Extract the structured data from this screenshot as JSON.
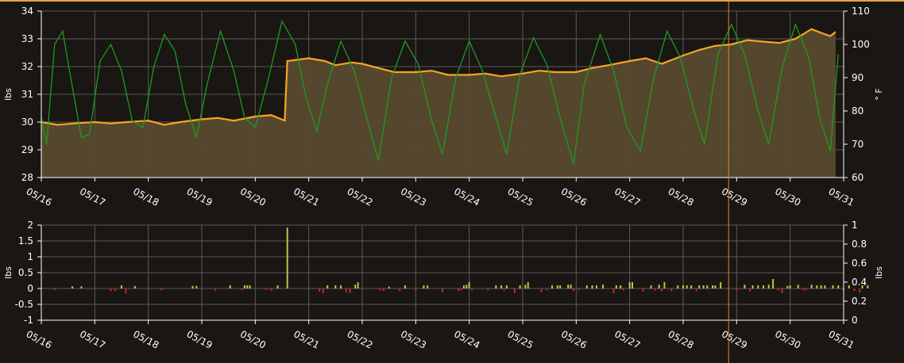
{
  "colors": {
    "background": "#1a1613",
    "grid": "#5b5a58",
    "weight_line": "#f5a623",
    "weight_fill": "#584a2e",
    "temperature_line": "#1f9a1f",
    "positive_bar": "#b7c84a",
    "negative_bar": "#c0282e",
    "cursor_line": "#d9892a"
  },
  "chart_data": [
    {
      "type": "area",
      "x_labels": [
        "05/16",
        "05/17",
        "05/18",
        "05/19",
        "05/20",
        "05/21",
        "05/22",
        "05/23",
        "05/24",
        "05/25",
        "05/26",
        "05/27",
        "05/28",
        "05/29",
        "05/30",
        "05/31"
      ],
      "ylabel_left": "lbs",
      "ylabel_right": "° F",
      "ylim_left": [
        28,
        34
      ],
      "ylim_right": [
        60,
        110
      ],
      "yticks_left": [
        "28",
        "29",
        "30",
        "31",
        "32",
        "33",
        "34"
      ],
      "yticks_right": [
        "60",
        "70",
        "80",
        "90",
        "100",
        "110"
      ],
      "grid": true,
      "series": [
        {
          "axis": "left",
          "style": "area",
          "points": [
            [
              0.0,
              30.0
            ],
            [
              0.3,
              29.9
            ],
            [
              0.6,
              29.95
            ],
            [
              1.0,
              30.0
            ],
            [
              1.3,
              29.95
            ],
            [
              1.6,
              30.0
            ],
            [
              2.0,
              30.05
            ],
            [
              2.3,
              29.9
            ],
            [
              2.6,
              30.0
            ],
            [
              3.0,
              30.1
            ],
            [
              3.3,
              30.15
            ],
            [
              3.6,
              30.05
            ],
            [
              4.0,
              30.2
            ],
            [
              4.3,
              30.25
            ],
            [
              4.55,
              30.05
            ],
            [
              4.6,
              32.2
            ],
            [
              5.0,
              32.3
            ],
            [
              5.3,
              32.2
            ],
            [
              5.5,
              32.05
            ],
            [
              5.8,
              32.15
            ],
            [
              6.0,
              32.1
            ],
            [
              6.3,
              31.95
            ],
            [
              6.6,
              31.8
            ],
            [
              7.0,
              31.8
            ],
            [
              7.3,
              31.85
            ],
            [
              7.6,
              31.7
            ],
            [
              8.0,
              31.7
            ],
            [
              8.3,
              31.75
            ],
            [
              8.6,
              31.65
            ],
            [
              9.0,
              31.75
            ],
            [
              9.3,
              31.85
            ],
            [
              9.6,
              31.8
            ],
            [
              10.0,
              31.8
            ],
            [
              10.3,
              31.95
            ],
            [
              10.6,
              32.05
            ],
            [
              11.0,
              32.2
            ],
            [
              11.3,
              32.3
            ],
            [
              11.6,
              32.1
            ],
            [
              12.0,
              32.4
            ],
            [
              12.3,
              32.6
            ],
            [
              12.6,
              32.75
            ],
            [
              12.9,
              32.8
            ],
            [
              13.2,
              32.95
            ],
            [
              13.5,
              32.9
            ],
            [
              13.8,
              32.85
            ],
            [
              14.1,
              33.0
            ],
            [
              14.4,
              33.35
            ],
            [
              14.6,
              33.2
            ],
            [
              14.75,
              33.1
            ],
            [
              14.85,
              33.25
            ]
          ]
        },
        {
          "axis": "right",
          "style": "line",
          "points": [
            [
              0.0,
              78
            ],
            [
              0.1,
              70
            ],
            [
              0.25,
              100
            ],
            [
              0.4,
              104
            ],
            [
              0.55,
              90
            ],
            [
              0.75,
              72
            ],
            [
              0.9,
              73
            ],
            [
              1.1,
              95
            ],
            [
              1.3,
              100
            ],
            [
              1.5,
              92
            ],
            [
              1.7,
              77
            ],
            [
              1.9,
              75
            ],
            [
              2.1,
              93
            ],
            [
              2.3,
              103
            ],
            [
              2.5,
              98
            ],
            [
              2.7,
              82
            ],
            [
              2.9,
              72
            ],
            [
              3.1,
              88
            ],
            [
              3.35,
              104
            ],
            [
              3.6,
              92
            ],
            [
              3.8,
              78
            ],
            [
              4.0,
              75
            ],
            [
              4.25,
              90
            ],
            [
              4.5,
              107
            ],
            [
              4.75,
              100
            ],
            [
              4.95,
              84
            ],
            [
              5.15,
              74
            ],
            [
              5.35,
              88
            ],
            [
              5.6,
              101
            ],
            [
              5.85,
              92
            ],
            [
              6.1,
              77
            ],
            [
              6.3,
              65
            ],
            [
              6.55,
              90
            ],
            [
              6.8,
              101
            ],
            [
              7.05,
              94
            ],
            [
              7.3,
              77
            ],
            [
              7.5,
              67
            ],
            [
              7.75,
              90
            ],
            [
              8.0,
              101
            ],
            [
              8.25,
              92
            ],
            [
              8.5,
              78
            ],
            [
              8.7,
              67
            ],
            [
              8.95,
              91
            ],
            [
              9.2,
              102
            ],
            [
              9.45,
              94
            ],
            [
              9.7,
              78
            ],
            [
              9.95,
              64
            ],
            [
              10.15,
              88
            ],
            [
              10.45,
              103
            ],
            [
              10.7,
              92
            ],
            [
              10.95,
              75
            ],
            [
              11.2,
              68
            ],
            [
              11.45,
              90
            ],
            [
              11.7,
              104
            ],
            [
              11.95,
              96
            ],
            [
              12.2,
              80
            ],
            [
              12.4,
              70
            ],
            [
              12.65,
              97
            ],
            [
              12.9,
              106
            ],
            [
              13.15,
              97
            ],
            [
              13.4,
              80
            ],
            [
              13.6,
              70
            ],
            [
              13.85,
              93
            ],
            [
              14.1,
              106
            ],
            [
              14.35,
              96
            ],
            [
              14.55,
              78
            ],
            [
              14.75,
              68
            ],
            [
              14.9,
              97
            ]
          ]
        }
      ],
      "cursor_x": 12.85
    },
    {
      "type": "bar",
      "x_labels": [
        "05/16",
        "05/17",
        "05/18",
        "05/19",
        "05/20",
        "05/21",
        "05/22",
        "05/23",
        "05/24",
        "05/25",
        "05/26",
        "05/27",
        "05/28",
        "05/29",
        "05/30",
        "05/31"
      ],
      "ylabel_left": "lbs",
      "ylabel_right": "lbs",
      "ylim_left": [
        -1,
        2
      ],
      "ylim_right": [
        0,
        1
      ],
      "yticks_left": [
        "-1",
        "-0.5",
        "0",
        "0.5",
        "1",
        "1.5",
        "2"
      ],
      "yticks_right": [
        "0",
        "0.2",
        "0.4",
        "0.6",
        "0.8",
        "1"
      ],
      "grid": true,
      "bars": [
        [
          0.25,
          -0.05
        ],
        [
          0.58,
          0.07
        ],
        [
          0.75,
          0.07
        ],
        [
          1.3,
          -0.08
        ],
        [
          1.38,
          -0.08
        ],
        [
          1.5,
          0.1
        ],
        [
          1.58,
          -0.15
        ],
        [
          1.75,
          0.08
        ],
        [
          2.25,
          -0.06
        ],
        [
          2.83,
          0.08
        ],
        [
          2.9,
          0.08
        ],
        [
          3.25,
          -0.07
        ],
        [
          3.53,
          0.1
        ],
        [
          3.75,
          -0.06
        ],
        [
          3.8,
          0.1
        ],
        [
          3.85,
          0.1
        ],
        [
          3.9,
          0.1
        ],
        [
          4.2,
          -0.05
        ],
        [
          4.3,
          -0.07
        ],
        [
          4.42,
          0.1
        ],
        [
          4.6,
          1.92
        ],
        [
          5.2,
          -0.1
        ],
        [
          5.27,
          -0.15
        ],
        [
          5.35,
          0.1
        ],
        [
          5.5,
          0.1
        ],
        [
          5.6,
          0.1
        ],
        [
          5.7,
          -0.12
        ],
        [
          5.77,
          -0.15
        ],
        [
          5.87,
          0.12
        ],
        [
          5.92,
          0.2
        ],
        [
          6.33,
          -0.06
        ],
        [
          6.4,
          -0.08
        ],
        [
          6.5,
          0.06
        ],
        [
          6.7,
          -0.08
        ],
        [
          6.8,
          0.1
        ],
        [
          7.0,
          -0.08
        ],
        [
          7.15,
          0.1
        ],
        [
          7.22,
          0.1
        ],
        [
          7.5,
          -0.12
        ],
        [
          7.8,
          -0.08
        ],
        [
          7.85,
          -0.06
        ],
        [
          7.9,
          0.1
        ],
        [
          7.95,
          0.12
        ],
        [
          8.0,
          0.2
        ],
        [
          8.05,
          -0.06
        ],
        [
          8.35,
          -0.06
        ],
        [
          8.5,
          0.1
        ],
        [
          8.6,
          0.1
        ],
        [
          8.65,
          -0.07
        ],
        [
          8.7,
          0.1
        ],
        [
          8.85,
          -0.15
        ],
        [
          8.95,
          0.1
        ],
        [
          9.05,
          0.12
        ],
        [
          9.1,
          0.2
        ],
        [
          9.35,
          -0.12
        ],
        [
          9.45,
          -0.06
        ],
        [
          9.55,
          0.1
        ],
        [
          9.65,
          0.1
        ],
        [
          9.7,
          0.1
        ],
        [
          9.85,
          0.12
        ],
        [
          9.9,
          0.12
        ],
        [
          9.95,
          -0.08
        ],
        [
          10.05,
          -0.06
        ],
        [
          10.2,
          0.1
        ],
        [
          10.3,
          0.1
        ],
        [
          10.38,
          0.1
        ],
        [
          10.5,
          0.12
        ],
        [
          10.7,
          -0.15
        ],
        [
          10.75,
          0.1
        ],
        [
          10.83,
          0.1
        ],
        [
          10.88,
          -0.06
        ],
        [
          11.0,
          0.2
        ],
        [
          11.05,
          0.2
        ],
        [
          11.25,
          -0.1
        ],
        [
          11.4,
          0.1
        ],
        [
          11.48,
          -0.06
        ],
        [
          11.55,
          0.12
        ],
        [
          11.6,
          -0.08
        ],
        [
          11.65,
          0.2
        ],
        [
          11.78,
          -0.08
        ],
        [
          11.9,
          0.1
        ],
        [
          12.0,
          0.1
        ],
        [
          12.07,
          0.1
        ],
        [
          12.15,
          0.1
        ],
        [
          12.25,
          -0.08
        ],
        [
          12.3,
          0.1
        ],
        [
          12.38,
          0.1
        ],
        [
          12.45,
          0.1
        ],
        [
          12.55,
          0.1
        ],
        [
          12.6,
          0.1
        ],
        [
          12.7,
          0.2
        ],
        [
          13.0,
          -0.06
        ],
        [
          13.15,
          0.12
        ],
        [
          13.25,
          -0.1
        ],
        [
          13.3,
          0.1
        ],
        [
          13.4,
          0.1
        ],
        [
          13.5,
          0.1
        ],
        [
          13.6,
          0.12
        ],
        [
          13.68,
          0.3
        ],
        [
          13.78,
          -0.06
        ],
        [
          13.85,
          -0.15
        ],
        [
          13.95,
          0.08
        ],
        [
          14.0,
          0.1
        ],
        [
          14.15,
          0.12
        ],
        [
          14.25,
          -0.06
        ],
        [
          14.3,
          -0.06
        ],
        [
          14.4,
          0.12
        ],
        [
          14.5,
          0.1
        ],
        [
          14.58,
          0.1
        ],
        [
          14.65,
          0.1
        ],
        [
          14.8,
          0.1
        ],
        [
          14.9,
          0.1
        ],
        [
          15.0,
          -0.06
        ],
        [
          15.1,
          0.1
        ],
        [
          15.2,
          -0.08
        ],
        [
          15.3,
          -0.12
        ],
        [
          15.35,
          0.1
        ],
        [
          15.45,
          0.1
        ]
      ],
      "cursor_x": 12.85
    }
  ]
}
